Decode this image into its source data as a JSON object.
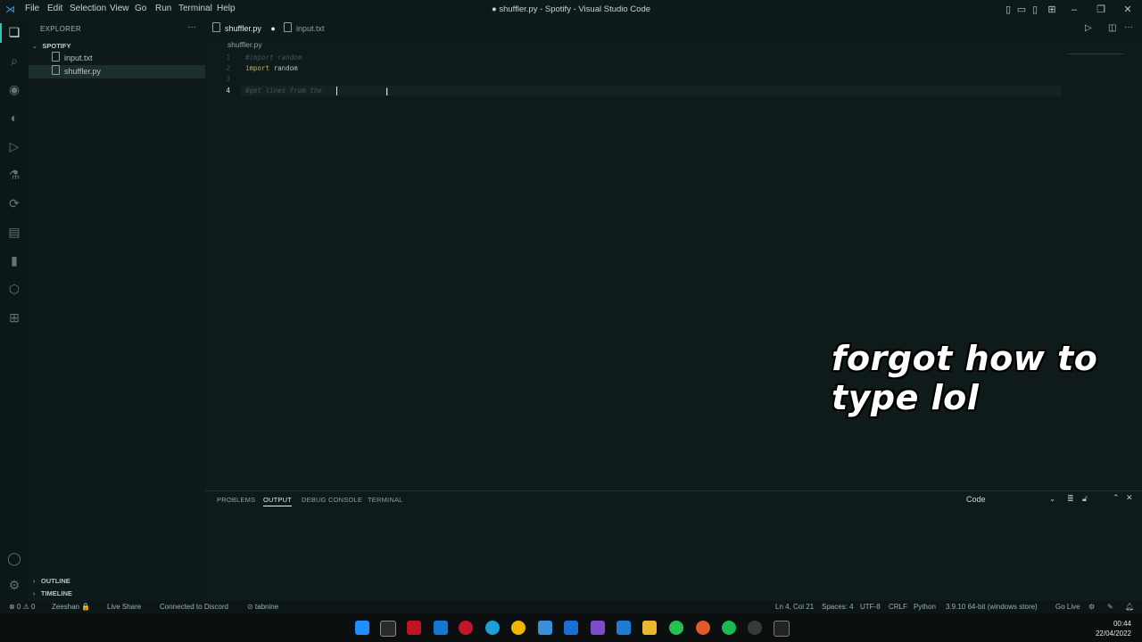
{
  "menubar": {
    "items": [
      "File",
      "Edit",
      "Selection",
      "View",
      "Go",
      "Run",
      "Terminal",
      "Help"
    ]
  },
  "window": {
    "title": "● shuffler.py - Spotify - Visual Studio Code"
  },
  "sidebar": {
    "title": "EXPLORER",
    "folder": "SPOTIFY",
    "files": [
      "input.txt",
      "shuffler.py"
    ],
    "sections": [
      "OUTLINE",
      "TIMELINE"
    ]
  },
  "tabs": [
    {
      "label": "shuffler.py",
      "modified": true,
      "active": true
    },
    {
      "label": "input.txt",
      "modified": false,
      "active": false
    }
  ],
  "breadcrumb": "shuffler.py",
  "editor": {
    "lines": [
      {
        "n": "1",
        "text": "#import random",
        "kind": "comment"
      },
      {
        "n": "2",
        "kw": "import",
        "text": " random",
        "kind": "code"
      },
      {
        "n": "3",
        "text": "",
        "kind": "blank"
      },
      {
        "n": "4",
        "text": "#get lines from the ",
        "kind": "comment"
      }
    ],
    "current_line": "4"
  },
  "caption": "forgot how to type lol",
  "panel": {
    "tabs": [
      "PROBLEMS",
      "OUTPUT",
      "DEBUG CONSOLE",
      "TERMINAL"
    ],
    "active_tab": "OUTPUT",
    "select_value": "Code"
  },
  "statusbar": {
    "left": [
      "⊗ 0 ⚠ 0",
      "Zeeshan 🔒",
      "Live Share",
      "Connected to Discord",
      "⊙ tabnine"
    ],
    "right": [
      "Ln 4, Col 21",
      "Spaces: 4",
      "UTF-8",
      "CRLF",
      "Python",
      "3.9.10 64-bit (windows store)",
      "Go Live"
    ]
  },
  "clock": {
    "time": "00:44",
    "date": "22/04/2022"
  },
  "colors": {
    "accent": "#2fc3b6",
    "background": "#0f1b1b"
  }
}
